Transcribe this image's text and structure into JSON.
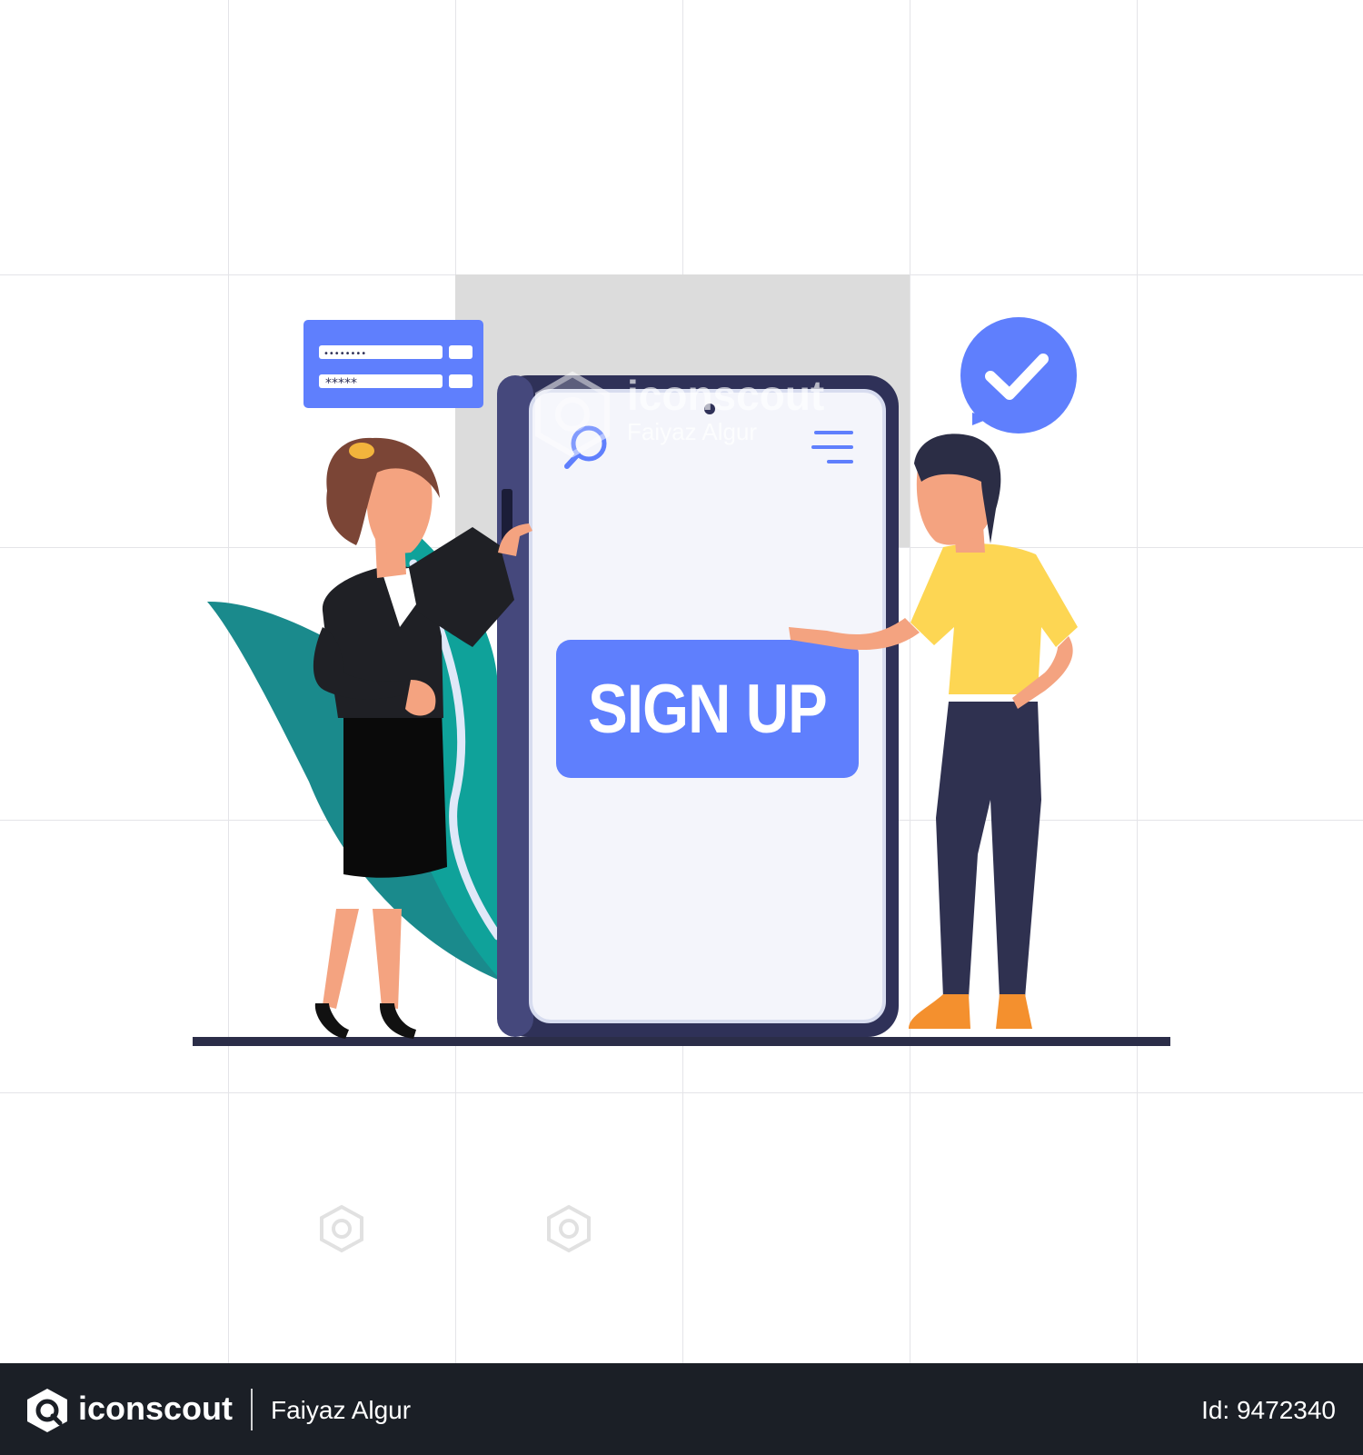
{
  "screen": {
    "signup_label": "SIGN UP"
  },
  "login_card": {
    "password_dots": "••••••••",
    "password_stars": "*****"
  },
  "watermark": {
    "brand": "iconscout",
    "author": "Faiyaz Algur"
  },
  "footer": {
    "brand": "iconscout",
    "author": "Faiyaz Algur",
    "id_text": "Id: 9472340"
  },
  "colors": {
    "accent_blue": "#5f7ffd",
    "phone_frame": "#2f3158",
    "leaf_teal": "#0fa29a",
    "shirt_yellow": "#fdd653",
    "footer_bg": "#1b1f26"
  },
  "icons": [
    "search-icon",
    "menu-icon",
    "checkmark-icon",
    "iconscout-logo-icon"
  ]
}
